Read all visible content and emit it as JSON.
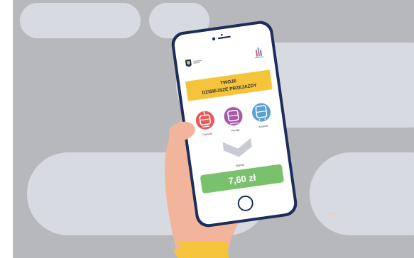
{
  "colors": {
    "background": "#ffffff",
    "panel_gray": "#b7b8bb",
    "cloud": "#d7dae1",
    "phone_frame": "#1d2d5c",
    "banner_yellow": "#f6c43a",
    "tram_red": "#e65a5a",
    "train_purple": "#a85aa8",
    "bus_blue": "#5aa0d8",
    "total_green": "#79c26b",
    "chevron_gray": "#c8ccd2",
    "skin": "#f3b49c",
    "sleeve": "#f6c43a"
  },
  "app": {
    "header_logo_left": "coat-of-arms-logo",
    "header_logo_right": "city-skyline-logo",
    "banner_line1": "TWOJE",
    "banner_line2": "DZISIEJSZE PRZEJAZDY",
    "modes": [
      {
        "label": "Tramwaj",
        "icon": "tram-icon"
      },
      {
        "label": "Pociąg",
        "icon": "train-icon"
      },
      {
        "label": "Autobus",
        "icon": "bus-icon"
      }
    ],
    "sum_label": "Suma:",
    "total": "7,60 zł"
  }
}
